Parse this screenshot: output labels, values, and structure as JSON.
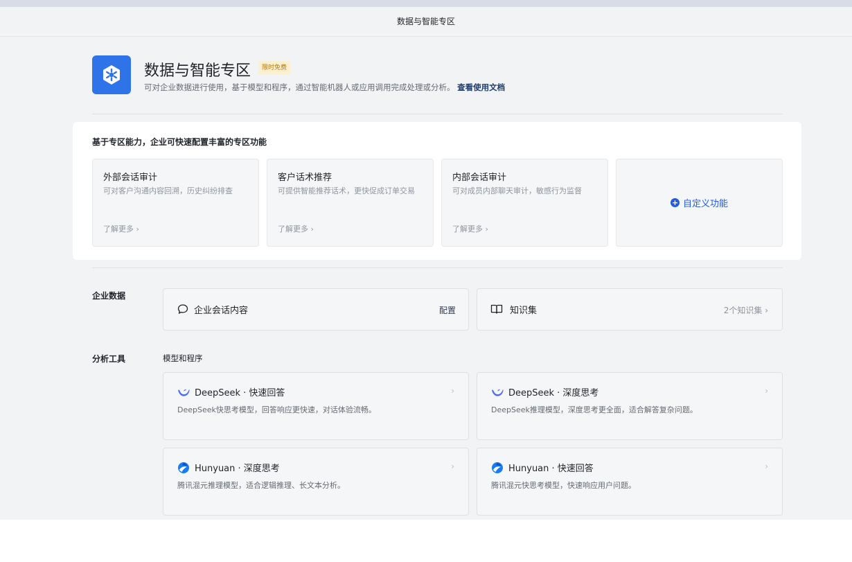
{
  "window": {
    "title": "数据与智能专区"
  },
  "header": {
    "title": "数据与智能专区",
    "badge": "限时免费",
    "description": "可对企业数据进行使用，基于模型和程序，通过智能机器人或应用调用完成处理或分析。",
    "doc_link": "查看使用文档"
  },
  "features": {
    "title": "基于专区能力，企业可快速配置丰富的专区功能",
    "cards": [
      {
        "title": "外部会话审计",
        "desc": "可对客户沟通内容回溯，历史纠纷排查",
        "more": "了解更多 ›"
      },
      {
        "title": "客户话术推荐",
        "desc": "可提供智能推荐话术，更快促成订单交易",
        "more": "了解更多 ›"
      },
      {
        "title": "内部会话审计",
        "desc": "可对成员内部聊天审计，敏感行为监督",
        "more": "了解更多 ›"
      }
    ],
    "custom": {
      "icon": "plus-circle-icon",
      "label": "自定义功能"
    }
  },
  "enterprise_data": {
    "label": "企业数据",
    "session": {
      "icon": "chat-bubble-icon",
      "title": "企业会话内容",
      "action": "配置"
    },
    "knowledge": {
      "icon": "open-book-icon",
      "title": "知识集",
      "count": "2个知识集 ›"
    }
  },
  "analysis": {
    "label": "分析工具",
    "sub_label": "模型和程序",
    "models": [
      {
        "icon": "deepseek-whale-icon",
        "title": "DeepSeek · 快速回答",
        "desc": "DeepSeek快思考模型，回答响应更快速，对话体验流畅。",
        "chevron": "›"
      },
      {
        "icon": "deepseek-whale-icon",
        "title": "DeepSeek · 深度思考",
        "desc": "DeepSeek推理模型，深度思考更全面，适合解答复杂问题。",
        "chevron": "›"
      },
      {
        "icon": "hunyuan-logo-icon",
        "title": "Hunyuan · 深度思考",
        "desc": "腾讯混元推理模型，适合逻辑推理、长文本分析。",
        "chevron": "›"
      },
      {
        "icon": "hunyuan-logo-icon",
        "title": "Hunyuan · 快速回答",
        "desc": "腾讯混元快思考模型，快速响应用户问题。",
        "chevron": "›"
      }
    ]
  },
  "colors": {
    "accent": "#245bdb",
    "logo_bg": "#2f73e8",
    "badge_bg": "#fdf0d0",
    "badge_text": "#b07a10",
    "page_bg": "#f2f3f5"
  }
}
